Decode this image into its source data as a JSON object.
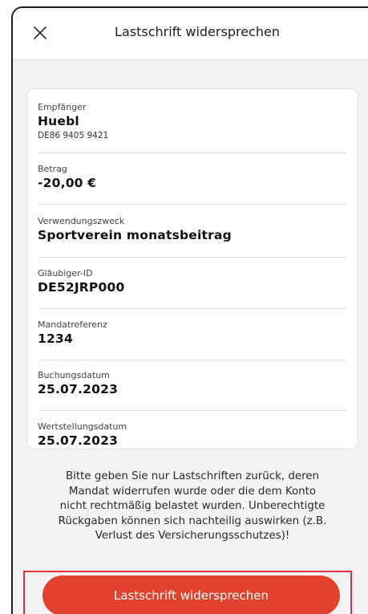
{
  "header": {
    "title": "Lastschrift widersprechen"
  },
  "details": {
    "recipient_label": "Empfänger",
    "recipient_name": "Huebl",
    "recipient_iban": "DE86 9405 9421",
    "amount_label": "Betrag",
    "amount_value": "-20,00 €",
    "purpose_label": "Verwendungszweck",
    "purpose_value": "Sportverein monatsbeitrag",
    "creditor_id_label": "Gläubiger-ID",
    "creditor_id_value": "DE52JRP000",
    "mandate_label": "Mandatreferenz",
    "mandate_value": "1234",
    "booking_date_label": "Buchungsdatum",
    "booking_date_value": "25.07.2023",
    "value_date_label": "Wertstellungsdatum",
    "value_date_value": "25.07.2023"
  },
  "disclaimer": {
    "line1": "Bitte geben Sie nur Lastschriften zurück, deren",
    "line2": "Mandat widerrufen wurde oder die dem Konto",
    "line3": "nicht rechtmäßig belastet wurden. Unberechtigte",
    "line4": "Rückgaben können sich nachteilig auswirken (z.B.",
    "line5": "Verlust des Versicherungsschutzes)!"
  },
  "action": {
    "submit_label": "Lastschrift widersprechen"
  },
  "colors": {
    "accent": "#e2412d",
    "highlight": "#d9343b"
  }
}
